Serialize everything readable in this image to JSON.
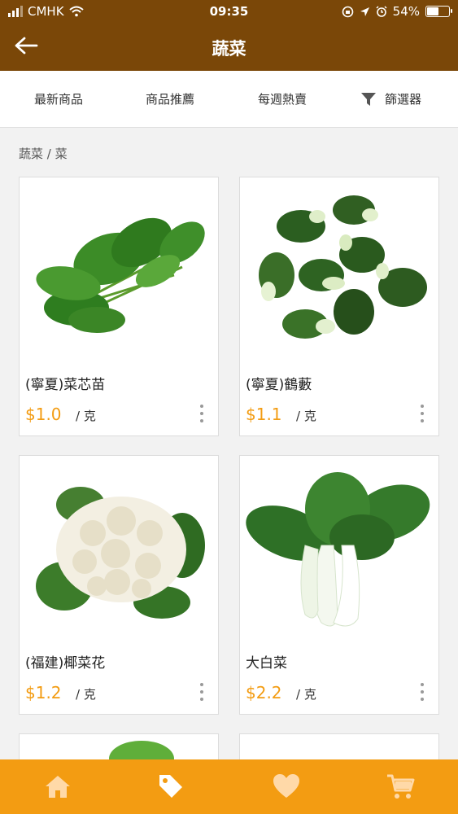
{
  "status_bar": {
    "carrier": "CMHK",
    "time": "09:35",
    "battery": "54%",
    "battery_level": 0.54
  },
  "header": {
    "title": "蔬菜"
  },
  "tabs": [
    {
      "label": "最新商品"
    },
    {
      "label": "商品推薦"
    },
    {
      "label": "每週熱賣"
    },
    {
      "label": "篩選器",
      "icon": "filter-icon"
    }
  ],
  "breadcrumb": "蔬菜 / 菜",
  "products": [
    {
      "name": "(寧夏)菜芯苗",
      "price": "$1.0",
      "unit": "/ 克"
    },
    {
      "name": "(寧夏)鶴藪",
      "price": "$1.1",
      "unit": "/ 克"
    },
    {
      "name": "(福建)椰菜花",
      "price": "$1.2",
      "unit": "/ 克"
    },
    {
      "name": "大白菜",
      "price": "$2.2",
      "unit": "/ 克"
    }
  ],
  "bottom_nav": [
    {
      "icon": "home-icon"
    },
    {
      "icon": "tag-icon"
    },
    {
      "icon": "heart-icon"
    },
    {
      "icon": "cart-icon"
    }
  ],
  "colors": {
    "header_bg": "#7a4708",
    "accent": "#f39c12",
    "price": "#f39c12"
  }
}
